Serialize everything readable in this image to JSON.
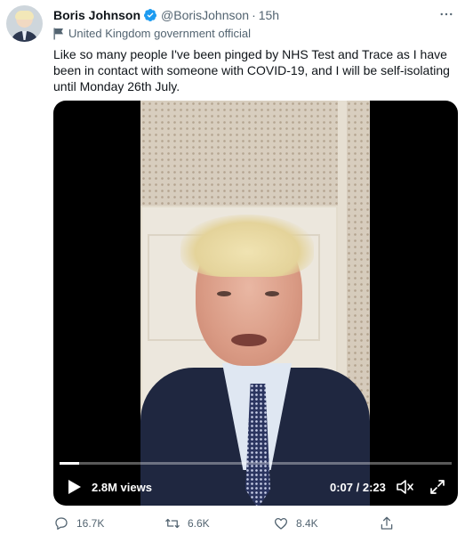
{
  "tweet": {
    "author_name": "Boris Johnson",
    "handle": "@BorisJohnson",
    "separator": "·",
    "time": "15h",
    "label": "United Kingdom government official",
    "text": "Like so many people I've been pinged by NHS Test and Trace as I have been in contact with someone with COVID-19, and I will be self-isolating until Monday 26th July."
  },
  "video": {
    "views": "2.8M views",
    "timecode": "0:07 / 2:23",
    "progress_fraction": 0.05
  },
  "actions": {
    "replies": "16.7K",
    "retweets": "6.6K",
    "likes": "8.4K"
  },
  "colors": {
    "verified": "#1d9bf0",
    "secondary_text": "#536471"
  }
}
